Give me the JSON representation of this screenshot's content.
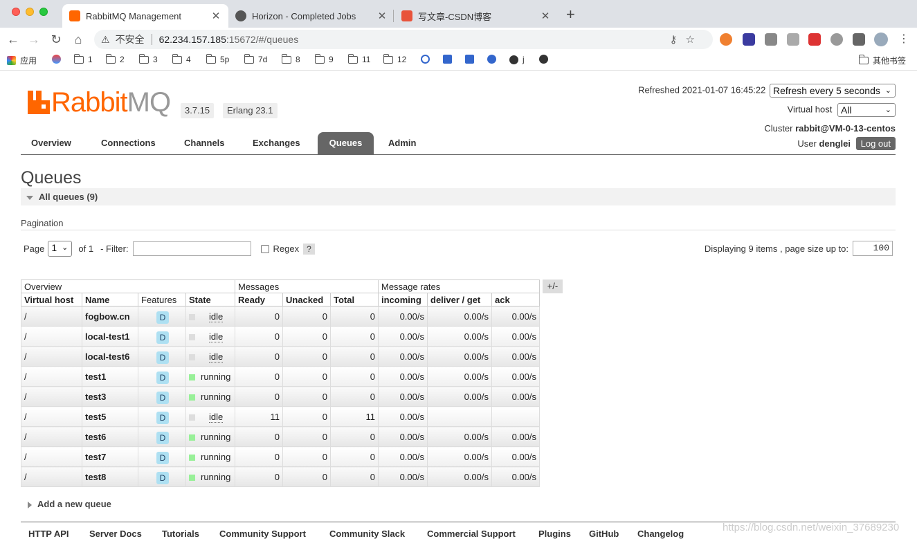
{
  "browser": {
    "tabs": [
      {
        "title": "RabbitMQ Management",
        "active": true
      },
      {
        "title": "Horizon - Completed Jobs",
        "active": false
      },
      {
        "title": "写文章-CSDN博客",
        "active": false
      }
    ],
    "url": {
      "security": "不安全",
      "host": "62.234.157.185",
      "path": ":15672/#/queues"
    },
    "bookmarks": [
      "应用",
      "1",
      "2",
      "3",
      "4",
      "5p",
      "7d",
      "8",
      "9",
      "11",
      "12",
      "j"
    ],
    "other_bookmarks": "其他书签"
  },
  "header": {
    "logo_rabbit": "Rabbit",
    "logo_mq": "MQ",
    "version": "3.7.15",
    "erlang": "Erlang 23.1",
    "refreshed_label": "Refreshed 2021-01-07 16:45:22",
    "refresh_option": "Refresh every 5 seconds",
    "vhost_label": "Virtual host",
    "vhost_value": "All",
    "cluster_label": "Cluster",
    "cluster_name": "rabbit@VM-0-13-centos",
    "user_label": "User",
    "user_name": "denglei",
    "logout": "Log out"
  },
  "nav": [
    "Overview",
    "Connections",
    "Channels",
    "Exchanges",
    "Queues",
    "Admin"
  ],
  "page": {
    "title": "Queues",
    "section": "All queues (9)",
    "pagination_label": "Pagination",
    "page_label": "Page",
    "page_value": "1",
    "of_label": "of 1",
    "filter_label": "- Filter:",
    "regex_label": "Regex",
    "help": "?",
    "display_label": "Displaying 9 items , page size up to:",
    "page_size": "100"
  },
  "table": {
    "groups": [
      "Overview",
      "Messages",
      "Message rates"
    ],
    "columns": [
      "Virtual host",
      "Name",
      "Features",
      "State",
      "Ready",
      "Unacked",
      "Total",
      "incoming",
      "deliver / get",
      "ack"
    ],
    "plusminus": "+/-",
    "rows": [
      {
        "vhost": "/",
        "name": "fogbow.cn",
        "feature": "D",
        "state": "idle",
        "ready": "0",
        "unacked": "0",
        "total": "0",
        "incoming": "0.00/s",
        "deliver": "0.00/s",
        "ack": "0.00/s"
      },
      {
        "vhost": "/",
        "name": "local-test1",
        "feature": "D",
        "state": "idle",
        "ready": "0",
        "unacked": "0",
        "total": "0",
        "incoming": "0.00/s",
        "deliver": "0.00/s",
        "ack": "0.00/s"
      },
      {
        "vhost": "/",
        "name": "local-test6",
        "feature": "D",
        "state": "idle",
        "ready": "0",
        "unacked": "0",
        "total": "0",
        "incoming": "0.00/s",
        "deliver": "0.00/s",
        "ack": "0.00/s"
      },
      {
        "vhost": "/",
        "name": "test1",
        "feature": "D",
        "state": "running",
        "ready": "0",
        "unacked": "0",
        "total": "0",
        "incoming": "0.00/s",
        "deliver": "0.00/s",
        "ack": "0.00/s"
      },
      {
        "vhost": "/",
        "name": "test3",
        "feature": "D",
        "state": "running",
        "ready": "0",
        "unacked": "0",
        "total": "0",
        "incoming": "0.00/s",
        "deliver": "0.00/s",
        "ack": "0.00/s"
      },
      {
        "vhost": "/",
        "name": "test5",
        "feature": "D",
        "state": "idle",
        "ready": "11",
        "unacked": "0",
        "total": "11",
        "incoming": "0.00/s",
        "deliver": "",
        "ack": ""
      },
      {
        "vhost": "/",
        "name": "test6",
        "feature": "D",
        "state": "running",
        "ready": "0",
        "unacked": "0",
        "total": "0",
        "incoming": "0.00/s",
        "deliver": "0.00/s",
        "ack": "0.00/s"
      },
      {
        "vhost": "/",
        "name": "test7",
        "feature": "D",
        "state": "running",
        "ready": "0",
        "unacked": "0",
        "total": "0",
        "incoming": "0.00/s",
        "deliver": "0.00/s",
        "ack": "0.00/s"
      },
      {
        "vhost": "/",
        "name": "test8",
        "feature": "D",
        "state": "running",
        "ready": "0",
        "unacked": "0",
        "total": "0",
        "incoming": "0.00/s",
        "deliver": "0.00/s",
        "ack": "0.00/s"
      }
    ]
  },
  "add_queue": "Add a new queue",
  "footer": [
    "HTTP API",
    "Server Docs",
    "Tutorials",
    "Community Support",
    "Community Slack",
    "Commercial Support",
    "Plugins",
    "GitHub",
    "Changelog"
  ],
  "watermark": "https://blog.csdn.net/weixin_37689230",
  "colors": {
    "brand": "#ff6600",
    "nav_active": "#666666",
    "running": "#98f098",
    "feature_badge": "#aee0f2"
  }
}
